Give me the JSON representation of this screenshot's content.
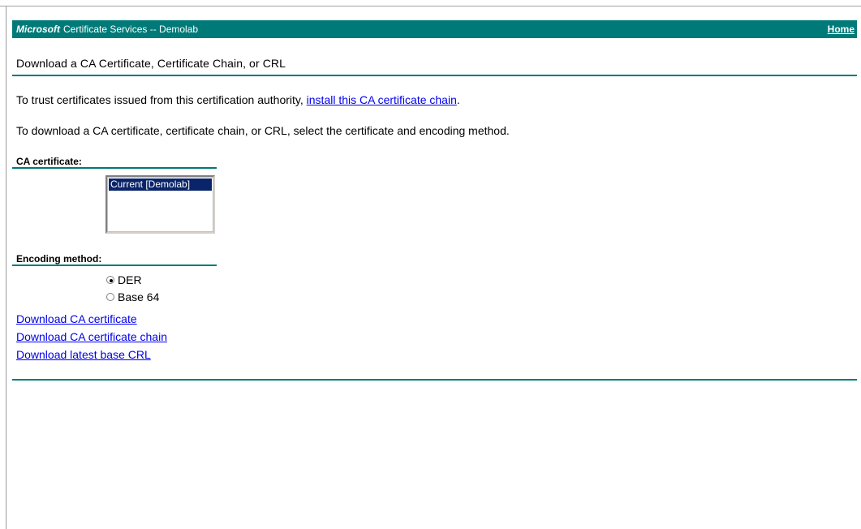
{
  "banner": {
    "brand": "Microsoft",
    "service": "Certificate Services  --  Demolab",
    "home": "Home"
  },
  "page_title": "Download a CA Certificate, Certificate Chain, or CRL",
  "intro": {
    "trust_prefix": "To trust certificates issued from this certification authority, ",
    "trust_link": "install this CA certificate chain",
    "trust_suffix": ".",
    "download_text": "To download a CA certificate, certificate chain, or CRL, select the certificate and encoding method."
  },
  "ca_certificate": {
    "label": "CA certificate:",
    "options": [
      "Current [Demolab]"
    ],
    "selected": "Current [Demolab]"
  },
  "encoding": {
    "label": "Encoding method:",
    "options": [
      {
        "label": "DER",
        "checked": true
      },
      {
        "label": "Base 64",
        "checked": false
      }
    ]
  },
  "downloads": {
    "ca_certificate": "Download CA certificate",
    "ca_chain": "Download CA certificate chain",
    "base_crl": "Download latest base CRL"
  },
  "colors": {
    "accent": "#007a78",
    "link": "#0000ee",
    "selection": "#0a246a"
  }
}
